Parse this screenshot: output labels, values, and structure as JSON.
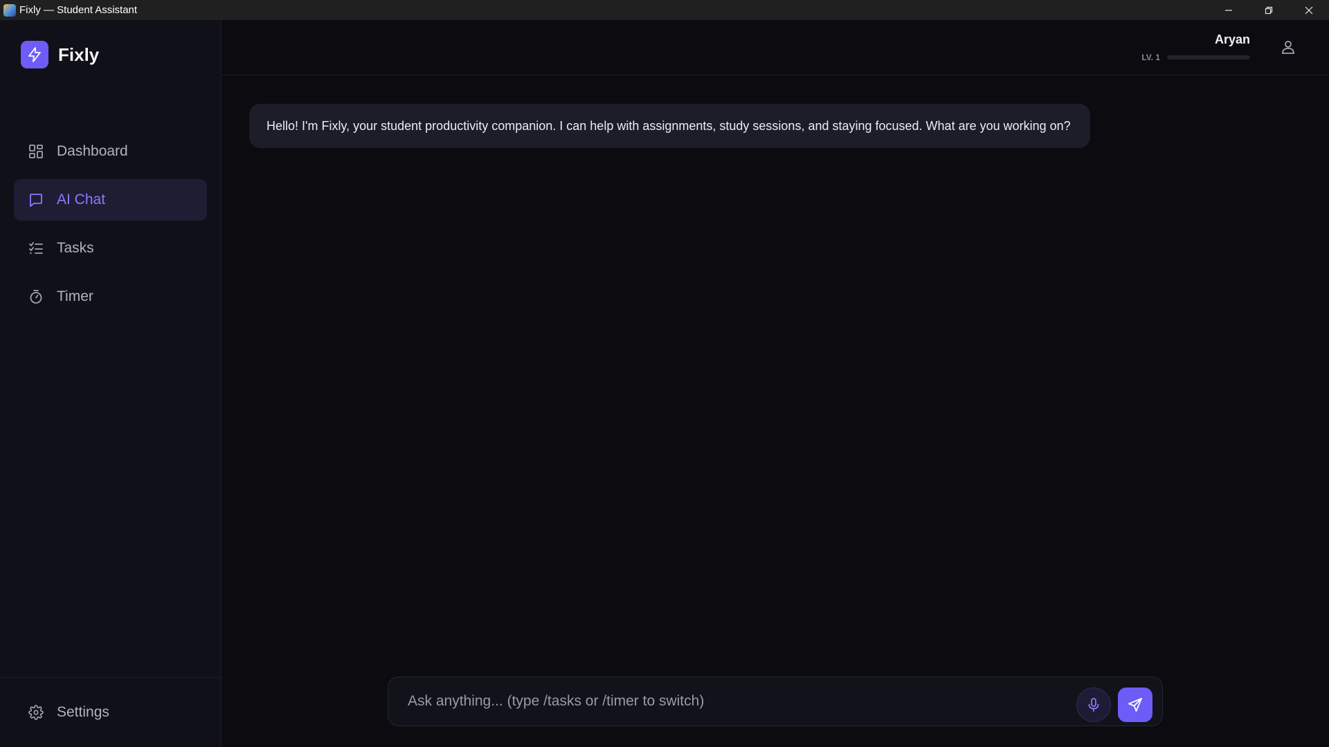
{
  "window": {
    "title": "Fixly — Student Assistant",
    "icon": "app-icon"
  },
  "sidebar": {
    "brand": {
      "name": "Fixly",
      "icon": "lightning-icon",
      "color": "#6d5cf6"
    },
    "items": [
      {
        "label": "Dashboard",
        "icon": "dashboard-grid-icon",
        "active": false
      },
      {
        "label": "AI Chat",
        "icon": "chat-bubble-icon",
        "active": true
      },
      {
        "label": "Tasks",
        "icon": "checklist-icon",
        "active": false
      },
      {
        "label": "Timer",
        "icon": "stopwatch-icon",
        "active": false
      }
    ],
    "footer": {
      "label": "Settings",
      "icon": "gear-icon"
    }
  },
  "header": {
    "user_name": "Aryan",
    "level_label": "LV. 1",
    "level_progress": 0,
    "profile_icon": "user-icon"
  },
  "chat": {
    "messages": [
      {
        "role": "assistant",
        "text": "Hello! I'm Fixly, your student productivity companion. I can help with assignments, study sessions, and staying focused. What are you working on?"
      }
    ]
  },
  "composer": {
    "placeholder": "Ask anything... (type /tasks or /timer to switch)",
    "value": "",
    "mic_icon": "microphone-icon",
    "send_icon": "send-icon"
  },
  "colors": {
    "accent": "#6d5cf6",
    "accent_text": "#8b7bff",
    "background": "#0b0b10",
    "sidebar": "#101019",
    "bubble": "#1d1d2a"
  }
}
